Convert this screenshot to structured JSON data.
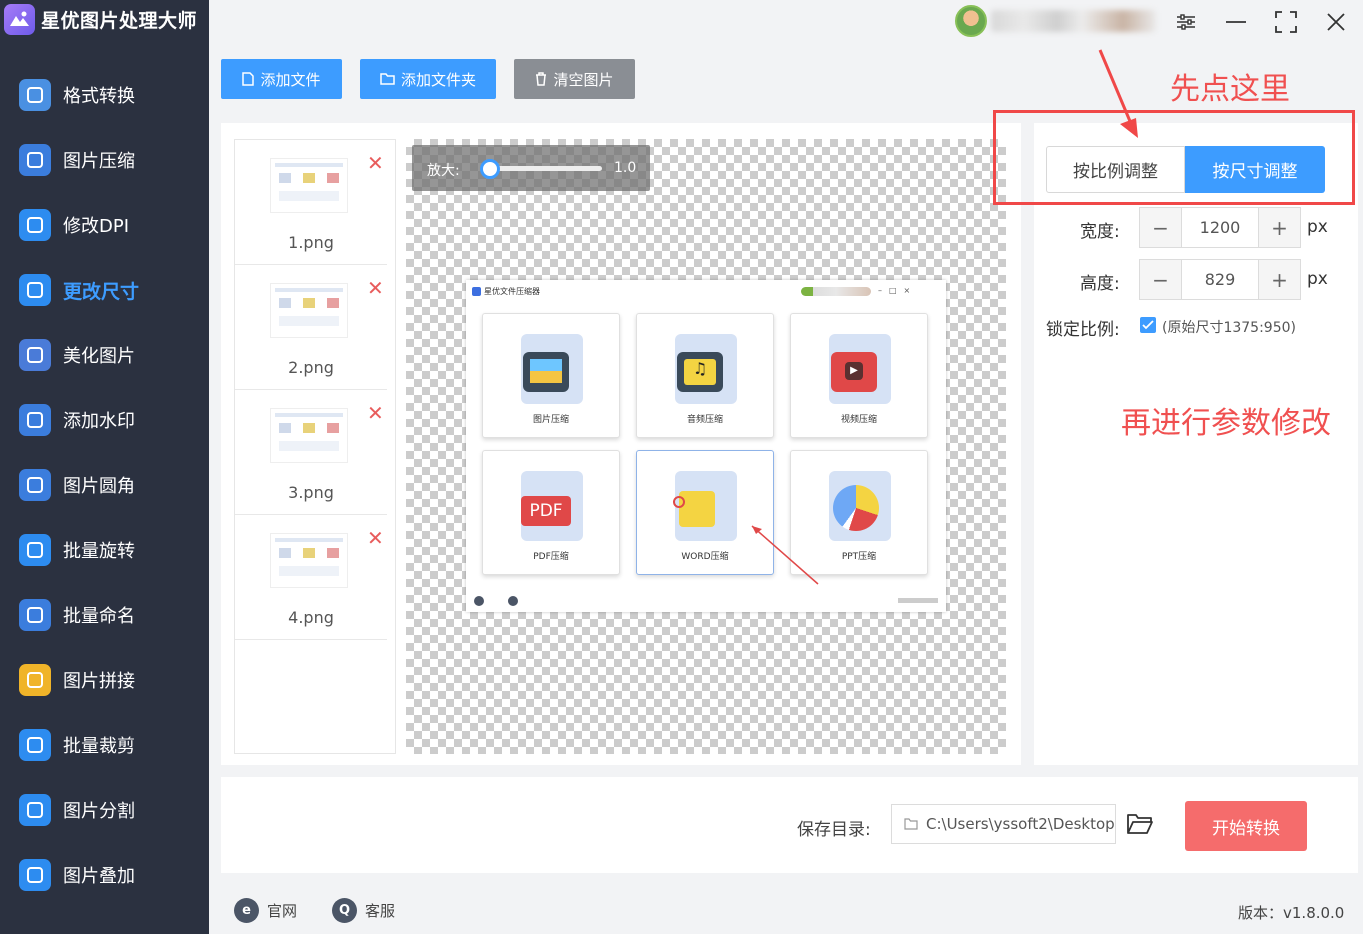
{
  "app": {
    "title": "星优图片处理大师"
  },
  "sidebar": {
    "items": [
      {
        "label": "格式转换",
        "icon": "format-convert-icon",
        "color": "#4a90e2"
      },
      {
        "label": "图片压缩",
        "icon": "image-compress-icon",
        "color": "#3b7ddd"
      },
      {
        "label": "修改DPI",
        "icon": "dpi-icon",
        "color": "#2d8cf0"
      },
      {
        "label": "更改尺寸",
        "icon": "resize-icon",
        "color": "#2d8cf0",
        "active": true
      },
      {
        "label": "美化图片",
        "icon": "beautify-icon",
        "color": "#4a7bd8"
      },
      {
        "label": "添加水印",
        "icon": "watermark-icon",
        "color": "#3b7ddd"
      },
      {
        "label": "图片圆角",
        "icon": "round-corner-icon",
        "color": "#3b7ddd"
      },
      {
        "label": "批量旋转",
        "icon": "rotate-icon",
        "color": "#2d8cf0"
      },
      {
        "label": "批量命名",
        "icon": "rename-icon",
        "color": "#3b7ddd"
      },
      {
        "label": "图片拼接",
        "icon": "stitch-icon",
        "color": "#f0b429"
      },
      {
        "label": "批量裁剪",
        "icon": "crop-icon",
        "color": "#2d8cf0"
      },
      {
        "label": "图片分割",
        "icon": "split-icon",
        "color": "#2d8cf0"
      },
      {
        "label": "图片叠加",
        "icon": "overlay-icon",
        "color": "#2d8cf0"
      }
    ]
  },
  "toolbar": {
    "add_file": "添加文件",
    "add_folder": "添加文件夹",
    "clear": "清空图片"
  },
  "files": [
    {
      "name": "1.png"
    },
    {
      "name": "2.png"
    },
    {
      "name": "3.png"
    },
    {
      "name": "4.png"
    }
  ],
  "preview": {
    "zoom_label": "放大:",
    "zoom_value": "1.0",
    "zoom_level": 0.1,
    "inner_title": "星优文件压缩器",
    "cards": [
      "图片压缩",
      "音频压缩",
      "视频压缩",
      "PDF压缩",
      "WORD压缩",
      "PPT压缩"
    ],
    "pdf_text": "PDF"
  },
  "settings": {
    "tab_ratio": "按比例调整",
    "tab_size": "按尺寸调整",
    "width_label": "宽度:",
    "width_value": "1200",
    "height_label": "高度:",
    "height_value": "829",
    "unit": "px",
    "lock_label": "锁定比例:",
    "lock_checked": true,
    "original": "(原始尺寸1375:950)"
  },
  "annotations": {
    "first": "先点这里",
    "second": "再进行参数修改"
  },
  "bottom": {
    "save_label": "保存目录:",
    "save_path": "C:\\Users\\yssoft2\\Desktop",
    "start": "开始转换"
  },
  "footer": {
    "website": "官网",
    "service": "客服",
    "version": "版本：v1.8.0.0"
  }
}
